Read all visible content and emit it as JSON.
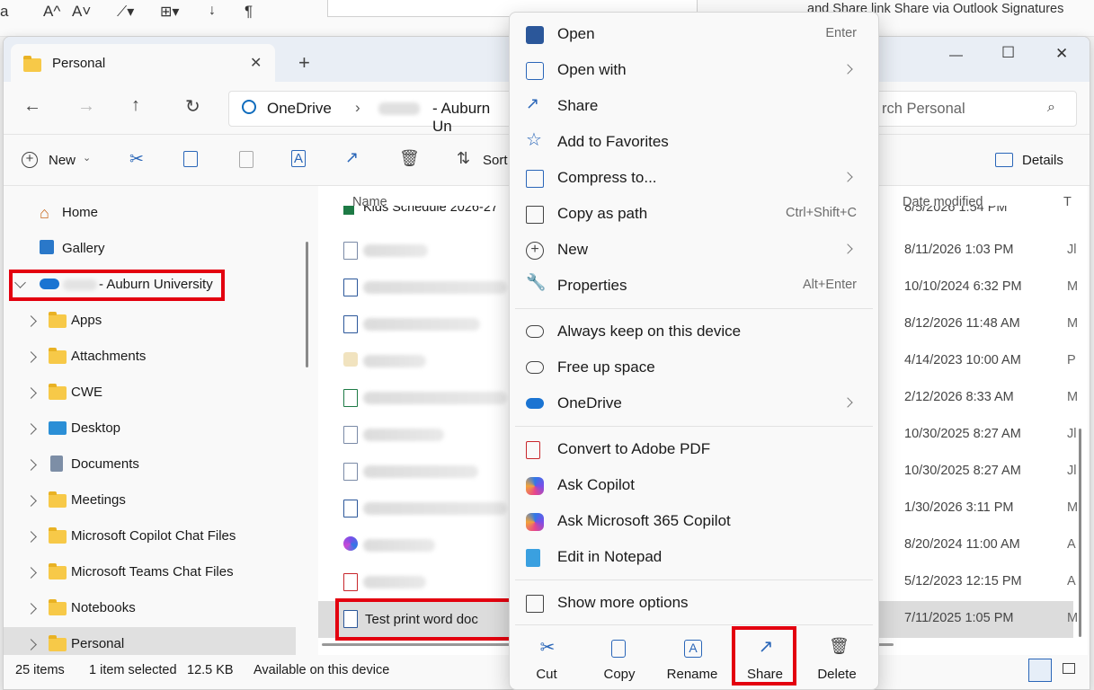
{
  "background_app": {
    "ribbon_items": [
      "a",
      "A^",
      "A˅",
      "¶"
    ],
    "outlook_text": "and Share link  Share via Outlook  Signatures"
  },
  "window": {
    "tab_title": "Personal",
    "new_tab_symbol": "+",
    "close_tab_symbol": "✕",
    "minimize_symbol": "—",
    "maximize_symbol": "☐",
    "close_symbol": "✕"
  },
  "address": {
    "root": "OneDrive",
    "segment": "- Auburn Un",
    "search_placeholder": "rch Personal"
  },
  "toolbar": {
    "new_label": "New",
    "sort_label": "Sort",
    "details_label": "Details"
  },
  "sidebar": {
    "home": "Home",
    "gallery": "Gallery",
    "onedrive_account": "- Auburn University",
    "folders": [
      "Apps",
      "Attachments",
      "CWE",
      "Desktop",
      "Documents",
      "Meetings",
      "Microsoft Copilot Chat Files",
      "Microsoft Teams Chat Files",
      "Notebooks",
      "Personal"
    ]
  },
  "files": {
    "col_name": "Name",
    "col_date": "Date modified",
    "col_type": "T",
    "top_partial_name": "Kids Schedule 2026-27",
    "top_partial_date": "8/5/2026 1:54 PM",
    "rows": [
      {
        "date": "8/11/2026 1:03 PM",
        "type": "Jl",
        "icon": "doc"
      },
      {
        "date": "10/10/2024 6:32 PM",
        "type": "M",
        "icon": "word"
      },
      {
        "date": "8/12/2026 11:48 AM",
        "type": "M",
        "icon": "word"
      },
      {
        "date": "4/14/2023 10:00 AM",
        "type": "P",
        "icon": "pen"
      },
      {
        "date": "2/12/2026 8:33 AM",
        "type": "M",
        "icon": "excel"
      },
      {
        "date": "10/30/2025 8:27 AM",
        "type": "Jl",
        "icon": "doc"
      },
      {
        "date": "10/30/2025 8:27 AM",
        "type": "Jl",
        "icon": "doc"
      },
      {
        "date": "1/30/2026 3:11 PM",
        "type": "M",
        "icon": "word"
      },
      {
        "date": "8/20/2024 11:00 AM",
        "type": "A",
        "icon": "loop"
      },
      {
        "date": "5/12/2023 12:15 PM",
        "type": "A",
        "icon": "pdf"
      }
    ],
    "selected_name": "Test print word doc",
    "selected_date": "7/11/2025 1:05 PM",
    "selected_type": "M"
  },
  "status": {
    "items": "25 items",
    "selected": "1 item selected",
    "size": "12.5 KB",
    "availability": "Available on this device"
  },
  "context_menu": {
    "open": "Open",
    "open_shortcut": "Enter",
    "open_with": "Open with",
    "share": "Share",
    "favorites": "Add to Favorites",
    "compress": "Compress to...",
    "copy_path": "Copy as path",
    "copy_path_shortcut": "Ctrl+Shift+C",
    "new": "New",
    "properties": "Properties",
    "properties_shortcut": "Alt+Enter",
    "keep": "Always keep on this device",
    "free": "Free up space",
    "onedrive": "OneDrive",
    "convert_pdf": "Convert to Adobe PDF",
    "ask_copilot": "Ask Copilot",
    "ask_m365": "Ask Microsoft 365 Copilot",
    "notepad": "Edit in Notepad",
    "more": "Show more options",
    "quick": {
      "cut": "Cut",
      "copy": "Copy",
      "rename": "Rename",
      "share": "Share",
      "delete": "Delete"
    }
  },
  "colors": {
    "highlight": "#e3000f",
    "accent": "#0f6cbd",
    "selection": "#dcdcdc"
  }
}
